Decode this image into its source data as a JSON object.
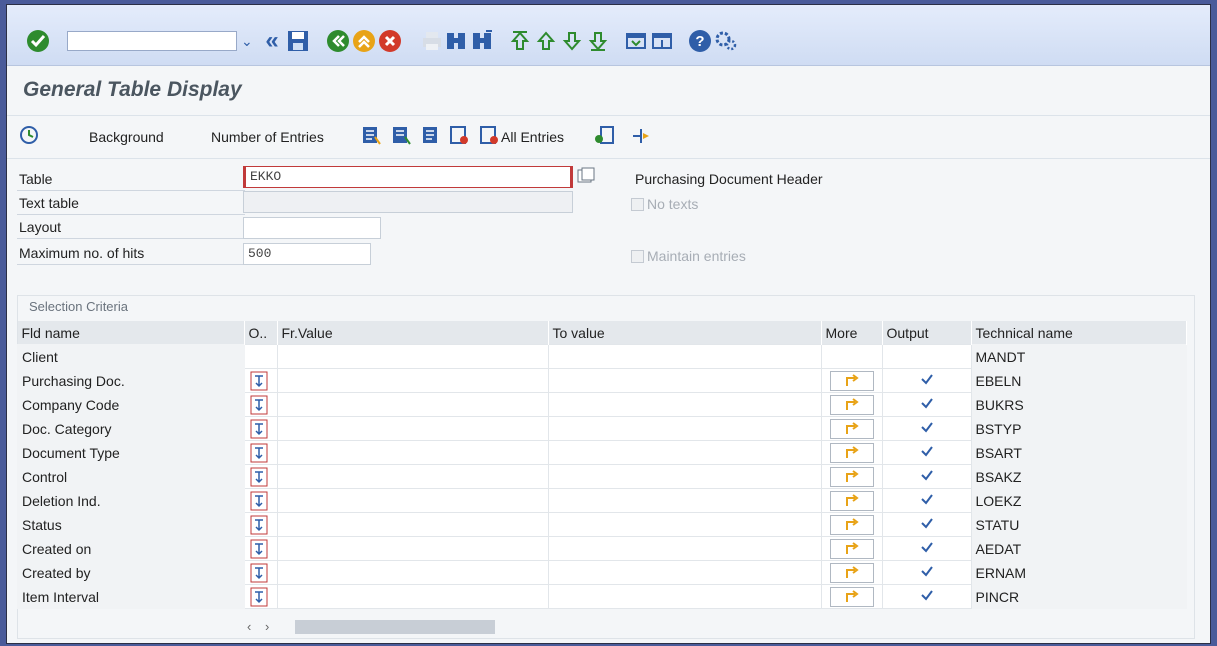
{
  "title": "General Table Display",
  "app_toolbar": {
    "background": "Background",
    "number_of_entries": "Number of Entries",
    "all_entries": "All Entries"
  },
  "form": {
    "table_label": "Table",
    "table_value": "EKKO",
    "table_description": "Purchasing Document Header",
    "text_table_label": "Text table",
    "no_texts_label": "No texts",
    "layout_label": "Layout",
    "max_hits_label": "Maximum no. of hits",
    "max_hits_value": "500",
    "maintain_entries_label": "Maintain entries"
  },
  "selection": {
    "group_label": "Selection Criteria",
    "columns": [
      "Fld name",
      "O..",
      "Fr.Value",
      "To value",
      "More",
      "Output",
      "Technical name"
    ],
    "rows": [
      {
        "name": "Client",
        "tech": "MANDT",
        "key": true,
        "has_controls": false
      },
      {
        "name": "Purchasing Doc.",
        "tech": "EBELN",
        "key": true,
        "has_controls": true
      },
      {
        "name": "Company Code",
        "tech": "BUKRS",
        "key": false,
        "has_controls": true
      },
      {
        "name": "Doc. Category",
        "tech": "BSTYP",
        "key": false,
        "has_controls": true
      },
      {
        "name": "Document Type",
        "tech": "BSART",
        "key": false,
        "has_controls": true
      },
      {
        "name": "Control",
        "tech": "BSAKZ",
        "key": false,
        "has_controls": true
      },
      {
        "name": "Deletion Ind.",
        "tech": "LOEKZ",
        "key": false,
        "has_controls": true
      },
      {
        "name": "Status",
        "tech": "STATU",
        "key": false,
        "has_controls": true
      },
      {
        "name": "Created on",
        "tech": "AEDAT",
        "key": false,
        "has_controls": true
      },
      {
        "name": "Created by",
        "tech": "ERNAM",
        "key": false,
        "has_controls": true
      },
      {
        "name": "Item Interval",
        "tech": "PINCR",
        "key": false,
        "has_controls": true
      }
    ]
  },
  "colors": {
    "accent": "#2e62a8",
    "ok_green": "#2e8b2e",
    "cancel_red": "#d23a2a",
    "toolbar_bg": "#dbe5f7"
  }
}
